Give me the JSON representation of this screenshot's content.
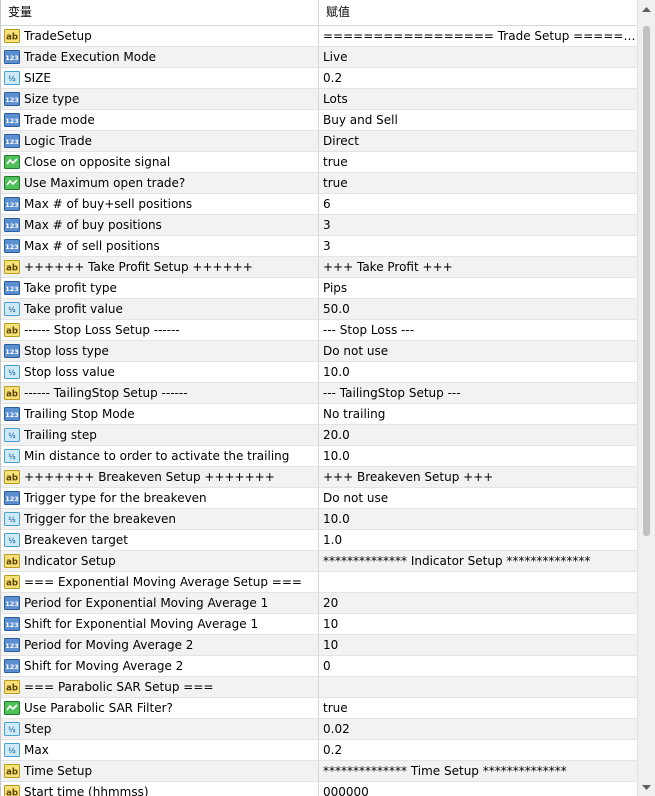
{
  "header": {
    "variable": "变量",
    "value": "赋值"
  },
  "rows": [
    {
      "icon": "ab",
      "name": "TradeSetup",
      "value": "================= Trade Setup ========..."
    },
    {
      "icon": "123",
      "name": "Trade Execution Mode",
      "value": "Live"
    },
    {
      "icon": "half",
      "name": "SIZE",
      "value": "0.2"
    },
    {
      "icon": "123",
      "name": "Size type",
      "value": "Lots"
    },
    {
      "icon": "123",
      "name": "Trade mode",
      "value": "Buy and Sell"
    },
    {
      "icon": "123",
      "name": "Logic Trade",
      "value": "Direct"
    },
    {
      "icon": "bool",
      "name": "Close on opposite signal",
      "value": "true"
    },
    {
      "icon": "bool",
      "name": "Use Maximum open trade?",
      "value": "true"
    },
    {
      "icon": "123",
      "name": "Max # of buy+sell positions",
      "value": "6"
    },
    {
      "icon": "123",
      "name": "Max # of buy positions",
      "value": "3"
    },
    {
      "icon": "123",
      "name": "Max # of sell positions",
      "value": "3"
    },
    {
      "icon": "ab",
      "name": "++++++ Take Profit Setup ++++++",
      "value": "+++ Take Profit +++"
    },
    {
      "icon": "123",
      "name": "Take profit type",
      "value": "Pips"
    },
    {
      "icon": "half",
      "name": "Take profit value",
      "value": "50.0"
    },
    {
      "icon": "ab",
      "name": "------ Stop Loss Setup ------",
      "value": "--- Stop Loss ---"
    },
    {
      "icon": "123",
      "name": "Stop loss type",
      "value": "Do not use"
    },
    {
      "icon": "half",
      "name": "Stop loss value",
      "value": "10.0"
    },
    {
      "icon": "ab",
      "name": "------ TailingStop Setup ------",
      "value": "--- TailingStop Setup ---"
    },
    {
      "icon": "123",
      "name": "Trailing Stop Mode",
      "value": "No trailing"
    },
    {
      "icon": "half",
      "name": "Trailing step",
      "value": "20.0"
    },
    {
      "icon": "half",
      "name": "Min distance to order to activate the trailing",
      "value": "10.0"
    },
    {
      "icon": "ab",
      "name": "+++++++ Breakeven Setup +++++++",
      "value": "+++ Breakeven Setup +++"
    },
    {
      "icon": "123",
      "name": "Trigger type for the breakeven",
      "value": "Do not use"
    },
    {
      "icon": "half",
      "name": "Trigger for the breakeven",
      "value": "10.0"
    },
    {
      "icon": "half",
      "name": "Breakeven target",
      "value": "1.0"
    },
    {
      "icon": "ab",
      "name": "Indicator Setup",
      "value": "************** Indicator Setup **************"
    },
    {
      "icon": "ab",
      "name": "=== Exponential Moving Average Setup ===",
      "value": ""
    },
    {
      "icon": "123",
      "name": "Period for Exponential Moving Average 1",
      "value": "20"
    },
    {
      "icon": "123",
      "name": "Shift for Exponential Moving Average 1",
      "value": "10"
    },
    {
      "icon": "123",
      "name": "Period for Moving Average 2",
      "value": "10"
    },
    {
      "icon": "123",
      "name": "Shift for Moving Average 2",
      "value": "0"
    },
    {
      "icon": "ab",
      "name": "=== Parabolic SAR Setup ===",
      "value": ""
    },
    {
      "icon": "bool",
      "name": "Use Parabolic SAR Filter?",
      "value": "true"
    },
    {
      "icon": "half",
      "name": "Step",
      "value": "0.02"
    },
    {
      "icon": "half",
      "name": "Max",
      "value": "0.2"
    },
    {
      "icon": "ab",
      "name": "Time Setup",
      "value": "************** Time Setup **************"
    },
    {
      "icon": "ab",
      "name": "Start time (hhmmss)",
      "value": "000000"
    }
  ]
}
